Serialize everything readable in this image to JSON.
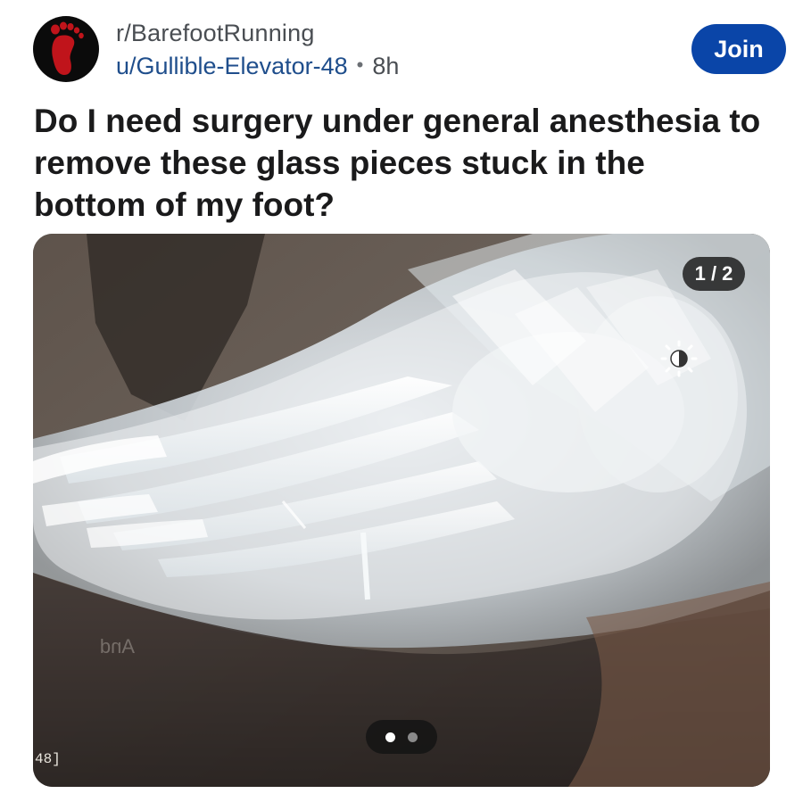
{
  "post": {
    "subreddit": "r/BarefootRunning",
    "username": "u/Gullible-Elevator-48",
    "separator": "•",
    "time": "8h",
    "join_label": "Join",
    "title": "Do I need surgery under general anesthesia to remove these glass pieces stuck in the bottom of my foot?"
  },
  "media": {
    "counter": "1 / 2",
    "current_index": 1,
    "total": 2,
    "edge_label": "48]",
    "pager_dots": [
      "active",
      "inactive"
    ]
  },
  "colors": {
    "join_button": "#0a45a8",
    "username": "#1f4e8c",
    "avatar_bg": "#0b0b0b",
    "avatar_foot": "#c0141b"
  },
  "icons": {
    "avatar": "red-footprint-icon",
    "brightness": "brightness-icon"
  }
}
